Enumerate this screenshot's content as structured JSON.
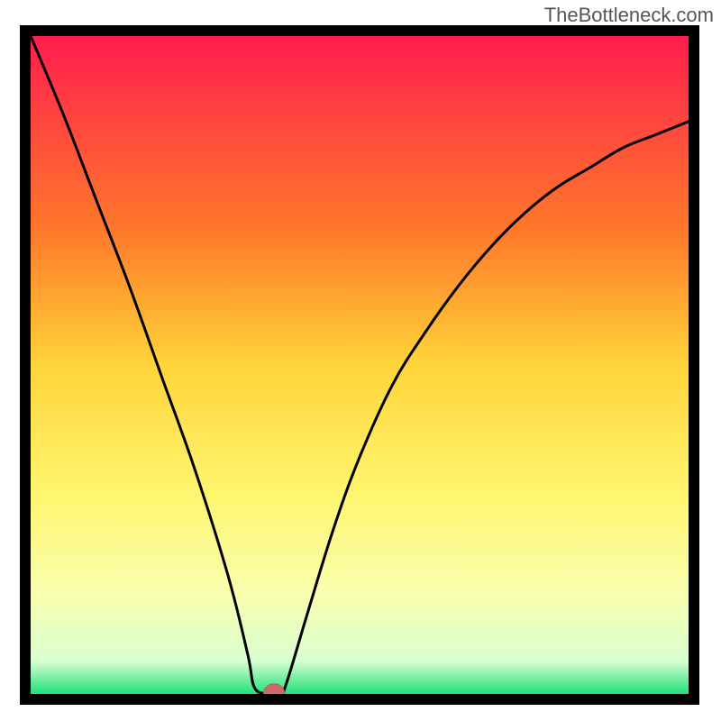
{
  "watermark": "TheBottleneck.com",
  "colors": {
    "frame": "#000000",
    "curve": "#000000",
    "marker_fill": "#d06a6a",
    "marker_stroke": "#b85858",
    "gradient_stops": [
      {
        "offset": 0.0,
        "color": "#ff1e4e"
      },
      {
        "offset": 0.3,
        "color": "#ff7a2a"
      },
      {
        "offset": 0.5,
        "color": "#ffd43a"
      },
      {
        "offset": 0.7,
        "color": "#fff670"
      },
      {
        "offset": 0.85,
        "color": "#f8ffb0"
      },
      {
        "offset": 0.95,
        "color": "#d8ffd0"
      },
      {
        "offset": 1.0,
        "color": "#22e07a"
      }
    ]
  },
  "chart_data": {
    "type": "line",
    "title": "",
    "xlabel": "",
    "ylabel": "",
    "xlim": [
      0,
      100
    ],
    "ylim": [
      0,
      100
    ],
    "optimum_x": 36,
    "curve": [
      {
        "x": 0,
        "y": 100
      },
      {
        "x": 5,
        "y": 88
      },
      {
        "x": 10,
        "y": 75
      },
      {
        "x": 15,
        "y": 62
      },
      {
        "x": 20,
        "y": 48
      },
      {
        "x": 25,
        "y": 34
      },
      {
        "x": 30,
        "y": 18
      },
      {
        "x": 33,
        "y": 6
      },
      {
        "x": 34,
        "y": 1
      },
      {
        "x": 36,
        "y": 0
      },
      {
        "x": 38,
        "y": 0
      },
      {
        "x": 39,
        "y": 2
      },
      {
        "x": 42,
        "y": 12
      },
      {
        "x": 46,
        "y": 25
      },
      {
        "x": 50,
        "y": 36
      },
      {
        "x": 55,
        "y": 47
      },
      {
        "x": 60,
        "y": 55
      },
      {
        "x": 65,
        "y": 62
      },
      {
        "x": 70,
        "y": 68
      },
      {
        "x": 75,
        "y": 73
      },
      {
        "x": 80,
        "y": 77
      },
      {
        "x": 85,
        "y": 80
      },
      {
        "x": 90,
        "y": 83
      },
      {
        "x": 95,
        "y": 85
      },
      {
        "x": 100,
        "y": 87
      }
    ],
    "marker": {
      "x": 37,
      "y": 0,
      "rx": 1.6,
      "ry": 1.0
    }
  }
}
